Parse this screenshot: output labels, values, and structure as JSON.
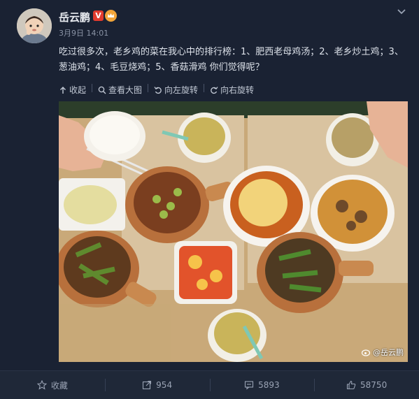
{
  "post": {
    "username": "岳云鹏",
    "verified_badge": "V",
    "timestamp": "3月9日 14:01",
    "text": "吃过很多次，老乡鸡的菜在我心中的排行榜：1、肥西老母鸡汤；2、老乡炒土鸡；3、葱油鸡；4、毛豆烧鸡；5、香菇滑鸡 你们觉得呢？"
  },
  "toolbar": {
    "collapse": "收起",
    "view_large": "查看大图",
    "rotate_left": "向左旋转",
    "rotate_right": "向右旋转"
  },
  "image": {
    "watermark": "@岳云鹏"
  },
  "footer": {
    "favorite": "收藏",
    "repost_count": "954",
    "comment_count": "5893",
    "like_count": "58750"
  },
  "colors": {
    "background": "#1a2233",
    "accent_red": "#e23b2e",
    "text": "#dde2ea",
    "muted": "#8a93a5"
  }
}
